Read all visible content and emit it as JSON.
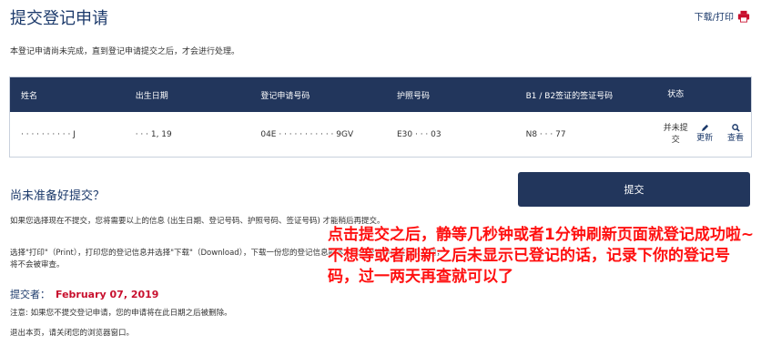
{
  "header": {
    "title": "提交登记申请",
    "print_label": "下载/打印"
  },
  "notice": "本登记申请尚未完成，直到登记申请提交之后，才会进行处理。",
  "table": {
    "headers": [
      "姓名",
      "出生日期",
      "登记申请号码",
      "护照号码",
      "B1 / B2签证的签证号码",
      "状态"
    ],
    "row": {
      "name": "·  ·  ·  ·  ·  ·  ·  ·  ·  ·  J",
      "dob": "·  ·  ·  1, 19",
      "app_no": "04E  ·  ·  ·  ·  ·  ·  ·  ·  ·  ·  ·  9GV",
      "passport": "E30  ·  ·  ·  03",
      "visa": "N8  ·  ·  ·  77",
      "status": "并未提交",
      "update_label": "更新",
      "view_label": "查看"
    }
  },
  "section": {
    "heading": "尚未准备好提交？",
    "submit_label": "提交",
    "para1": "如果您选择现在不提交，您将需要以上的信息 (出生日期、登记号码、护照号码、签证号码) 才能稍后再提交。",
    "para2": "选择\"打印\"（Print），打印您的登记信息并选择\"下载\"（Download），下载一份您的登记信息副本。您的登记申请在提交之前，将不会被审查。",
    "submitter_label": "提交者：",
    "submitter_date": "February 07, 2019",
    "note": "注意: 如果您不提交登记申请，您的申请将在此日期之后被删除。",
    "exit": "退出本页，请关闭您的浏览器窗口。"
  },
  "overlay_text": "点击提交之后，静等几秒钟或者1分钟刷新页面就登记成功啦~不想等或者刷新之后未显示已登记的话，记录下你的登记号码，过一两天再查就可以了",
  "colors": {
    "navy": "#22365c",
    "title": "#1c3a6b",
    "date_red": "#c8102e",
    "overlay_red": "#ff1010"
  },
  "icons": {
    "print": "printer-icon",
    "update": "pencil-icon",
    "view": "magnifier-icon"
  }
}
